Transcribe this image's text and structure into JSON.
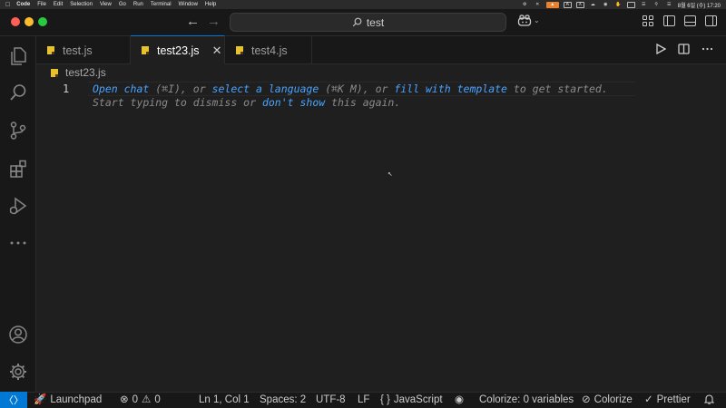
{
  "menubar": {
    "app_name": "Code",
    "items": [
      "File",
      "Edit",
      "Selection",
      "View",
      "Go",
      "Run",
      "Terminal",
      "Window",
      "Help"
    ],
    "clock": "8월 6일 (수) 17:20"
  },
  "titlebar": {
    "search_text": "test"
  },
  "tabs": [
    {
      "label": "test.js",
      "active": false
    },
    {
      "label": "test23.js",
      "active": true
    },
    {
      "label": "test4.js",
      "active": false
    }
  ],
  "breadcrumb": {
    "file": "test23.js"
  },
  "editor": {
    "line_number": "1",
    "hint1": {
      "open_chat": "Open chat",
      "open_chat_shortcut": " (⌘I), or ",
      "select_language": "select a language",
      "select_language_shortcut": " (⌘K M), or ",
      "fill_template": "fill with template",
      "suffix": " to get started."
    },
    "hint2": {
      "prefix": "Start typing to dismiss or ",
      "dont_show": "don't show",
      "suffix": " this again."
    }
  },
  "statusbar": {
    "launchpad": "Launchpad",
    "errors": "0",
    "warnings": "0",
    "position": "Ln 1, Col 1",
    "spaces": "Spaces: 2",
    "encoding": "UTF-8",
    "eol": "LF",
    "language": "JavaScript",
    "colorize_vars": "Colorize: 0 variables",
    "colorize": "Colorize",
    "prettier": "Prettier"
  },
  "colors": {
    "accent": "#0078d4",
    "link": "#4aa3ff",
    "js_badge": "#e8c22e"
  }
}
